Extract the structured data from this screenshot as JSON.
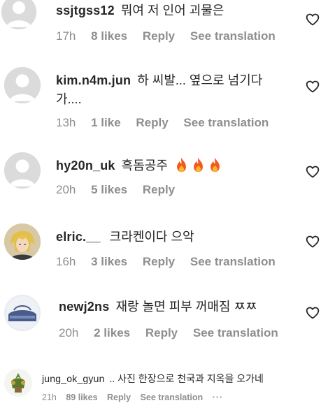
{
  "comments": [
    {
      "username": "ssjtgss12",
      "text": "뭐여 저 인어 괴물은",
      "time": "17h",
      "likes": "8 likes",
      "reply": "Reply",
      "translation": "See translation"
    },
    {
      "username": "kim.n4m.jun",
      "text": "하 씨발... 옆으로 넘기다",
      "text2": "가....",
      "time": "13h",
      "likes": "1 like",
      "reply": "Reply",
      "translation": "See translation"
    },
    {
      "username": "hy20n_uk",
      "text": "흑돔공주",
      "time": "20h",
      "likes": "5 likes",
      "reply": "Reply"
    },
    {
      "username": "elric.__",
      "text": "크라켄이다 으악",
      "time": "16h",
      "likes": "3 likes",
      "reply": "Reply",
      "translation": "See translation"
    },
    {
      "username": "newj2ns",
      "text": "재랑 놀면 피부 꺼매짐 ㅉㅉ",
      "time": "20h",
      "likes": "2 likes",
      "reply": "Reply",
      "translation": "See translation"
    },
    {
      "username": "jung_ok_gyun",
      "text": ".. 사진 한장으로 천국과 지옥을 오가네",
      "time": "21h",
      "likes": "89 likes",
      "reply": "Reply",
      "translation": "See translation",
      "more": "···"
    }
  ],
  "icons": {
    "heart": "heart-outline-icon",
    "fire": "fire-emoji-icon",
    "more": "more-options-icon"
  },
  "colors": {
    "text": "#262626",
    "meta": "#8e8e8e",
    "avatar_bg": "#dbdbdb"
  }
}
